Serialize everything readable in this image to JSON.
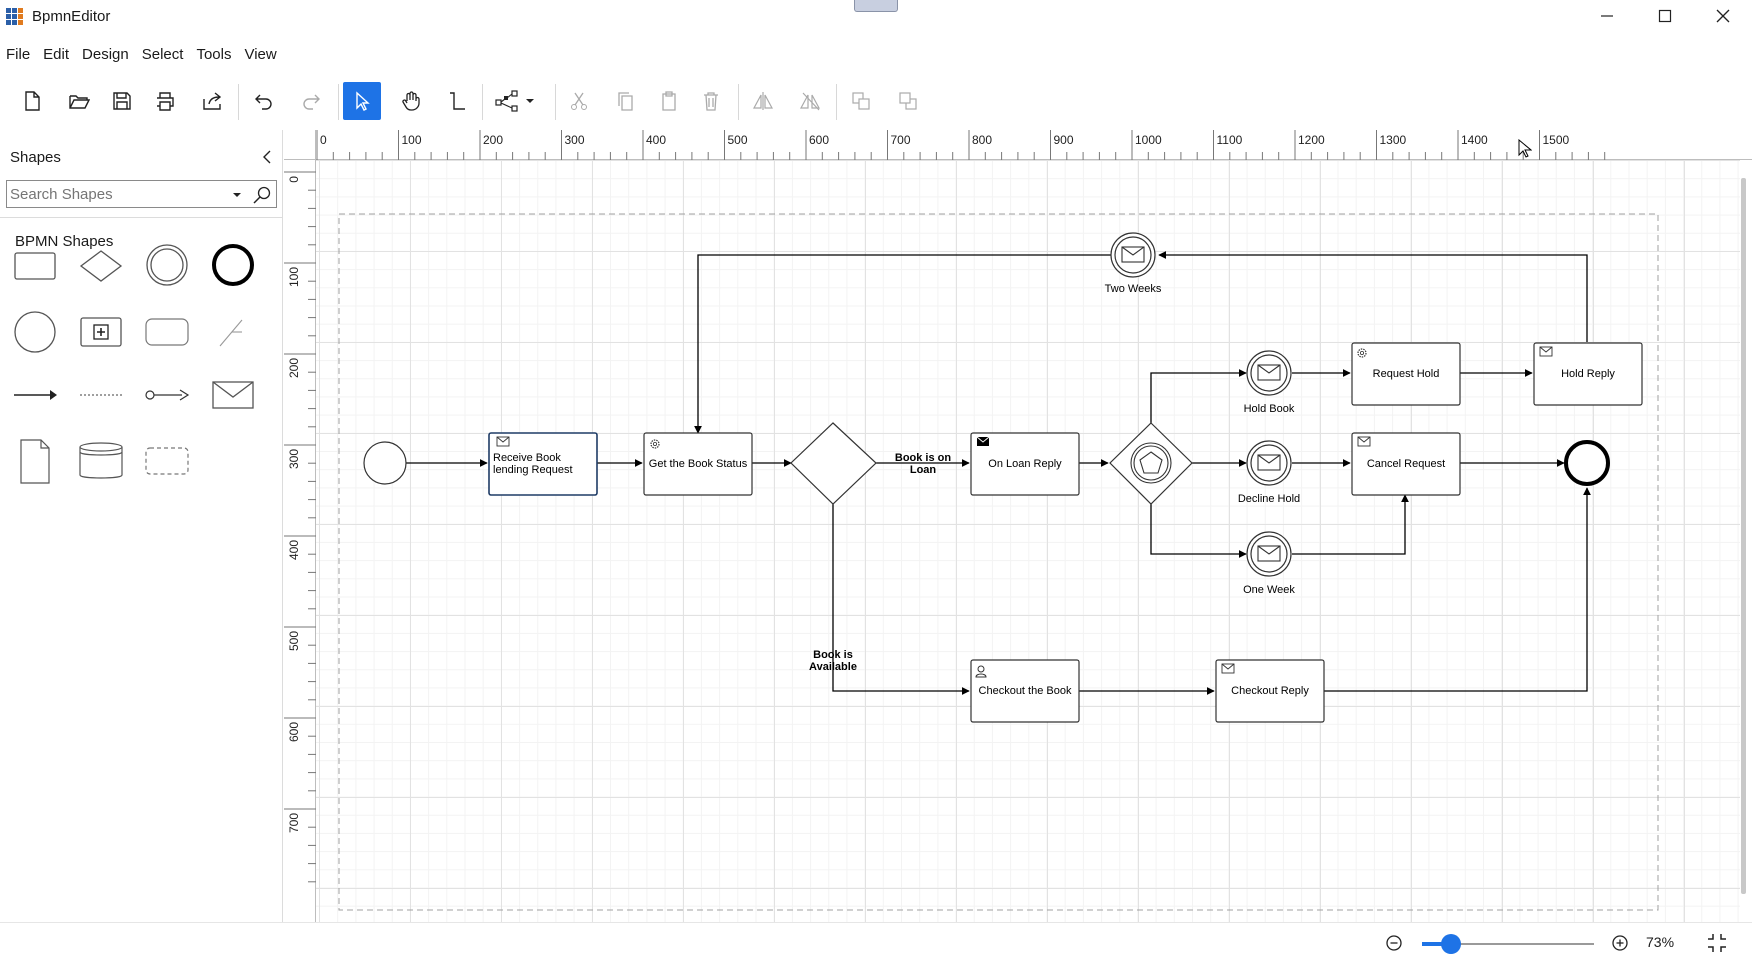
{
  "window": {
    "title": "BpmnEditor",
    "minimize_icon": "minimize-icon",
    "maximize_icon": "maximize-icon",
    "close_icon": "close-icon"
  },
  "menu": [
    "File",
    "Edit",
    "Design",
    "Select",
    "Tools",
    "View"
  ],
  "toolbar": {
    "tools": [
      "new-file",
      "open",
      "save",
      "print",
      "export",
      "undo",
      "redo",
      "select-pointer",
      "pan",
      "connector",
      "layout-dropdown",
      "cut",
      "copy",
      "paste",
      "delete",
      "flip-horizontal",
      "flip-vertical",
      "bring-forward",
      "send-backward"
    ],
    "active_tool": "select-pointer"
  },
  "shapes_panel": {
    "title": "Shapes",
    "search_placeholder": "Search Shapes",
    "category": "BPMN Shapes",
    "items": [
      "task",
      "gateway",
      "intermediate-event",
      "end-event",
      "start-event",
      "subprocess",
      "rounded-task",
      "association",
      "sequence-flow",
      "default-flow",
      "message-flow",
      "message",
      "data-object",
      "data-store",
      "group"
    ]
  },
  "rulers": {
    "horizontal_ticks": [
      "0",
      "100",
      "200",
      "300",
      "400",
      "500",
      "600",
      "700",
      "800",
      "900",
      "1000",
      "1100",
      "1200",
      "1300",
      "1400",
      "1500"
    ],
    "vertical_ticks": [
      "0",
      "100",
      "200",
      "300",
      "400",
      "500",
      "600",
      "700"
    ]
  },
  "diagram": {
    "nodes": {
      "start": "",
      "receive_request": "Receive Book lending Request",
      "get_status": "Get the Book Status",
      "on_loan_reply": "On Loan Reply",
      "hold_book": "Hold Book",
      "decline_hold": "Decline Hold",
      "one_week": "One Week",
      "two_weeks": "Two Weeks",
      "request_hold": "Request Hold",
      "hold_reply": "Hold Reply",
      "cancel_request": "Cancel Request",
      "checkout_book": "Checkout the Book",
      "checkout_reply": "Checkout Reply"
    },
    "edge_labels": {
      "on_loan": "Book is on Loan",
      "available": "Book is Available"
    }
  },
  "statusbar": {
    "zoom_percent": "73%",
    "zoom_fraction": 0.17
  },
  "colors": {
    "accent": "#1e73e6",
    "selection": "#1f3c66"
  }
}
